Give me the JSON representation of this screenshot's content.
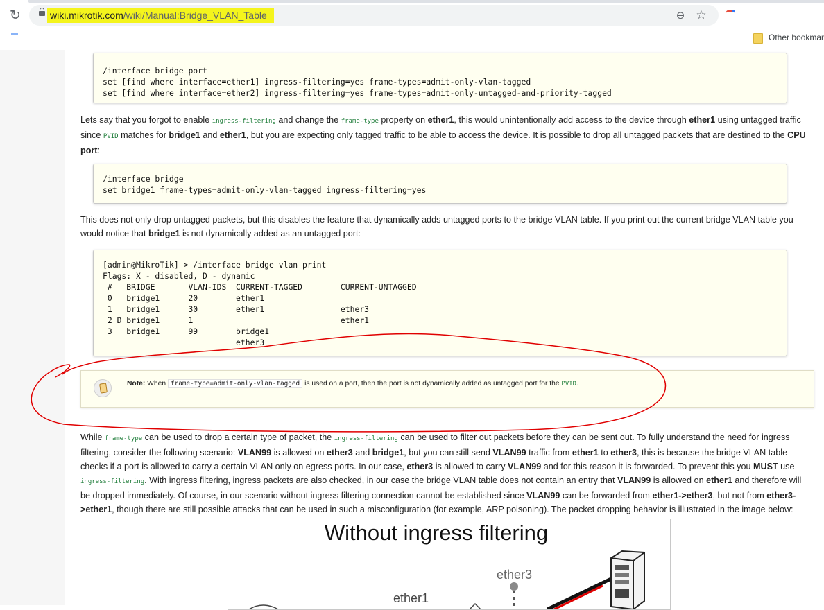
{
  "browser": {
    "url_host": "wiki.mikrotik.com",
    "url_path": "/wiki/Manual:Bridge_VLAN_Table",
    "bookmarks_label": "Other bookmar"
  },
  "code_block_1": {
    "lines": "/interface bridge port\nset [find where interface=ether1] ingress-filtering=yes frame-types=admit-only-vlan-tagged\nset [find where interface=ether2] ingress-filtering=yes frame-types=admit-only-untagged-and-priority-tagged"
  },
  "paragraph_1": {
    "t1": "Lets say that you forgot to enable ",
    "c1": "ingress-filtering",
    "t2": " and change the ",
    "c2": "frame-type",
    "t3": " property on ",
    "b1": "ether1",
    "t4": ", this would unintentionally add access to the device through ",
    "b2": "ether1",
    "t5": " using untagged traffic since ",
    "c3": "PVID",
    "t6": " matches for ",
    "b3": "bridge1",
    "t7": " and ",
    "b4": "ether1",
    "t8": ", but you are expecting only tagged traffic to be able to access the device. It is possible to drop all untagged packets that are destined to the ",
    "b5": "CPU port",
    "t9": ":"
  },
  "code_block_2": {
    "lines": "/interface bridge\nset bridge1 frame-types=admit-only-vlan-tagged ingress-filtering=yes"
  },
  "paragraph_2": {
    "t1": "This does not only drop untagged packets, but this disables the feature that dynamically adds untagged ports to the bridge VLAN table. If you print out the current bridge VLAN table you would notice that ",
    "b1": "bridge1",
    "t2": " is not dynamically added as an untagged port:"
  },
  "code_block_3": {
    "lines": "[admin@MikroTik] > /interface bridge vlan print\nFlags: X - disabled, D - dynamic\n #   BRIDGE       VLAN-IDS  CURRENT-TAGGED        CURRENT-UNTAGGED\n 0   bridge1      20        ether1\n 1   bridge1      30        ether1                ether3\n 2 D bridge1      1                               ether1\n 3   bridge1      99        bridge1\n                            ether3"
  },
  "note": {
    "label": "Note:",
    "t1": " When ",
    "code": "frame-type=admit-only-vlan-tagged",
    "t2": " is used on a port, then the port is not dynamically added as untagged port for the ",
    "c2": "PVID",
    "t3": "."
  },
  "paragraph_3": {
    "t1": "While ",
    "c1": "frame-type",
    "t2": " can be used to drop a certain type of packet, the ",
    "c2": "ingress-filtering",
    "t3": " can be used to filter out packets before they can be sent out. To fully understand the need for ingress filtering, consider the following scenario: ",
    "b1": "VLAN99",
    "t4": " is allowed on ",
    "b2": "ether3",
    "t5": " and ",
    "b3": "bridge1",
    "t6": ", but you can still send ",
    "b4": "VLAN99",
    "t7": " traffic from ",
    "b5": "ether1",
    "t8": " to ",
    "b6": "ether3",
    "t9": ", this is because the bridge VLAN table checks if a port is allowed to carry a certain VLAN only on egress ports. In our case, ",
    "b7": "ether3",
    "t10": " is allowed to carry ",
    "b8": "VLAN99",
    "t11": " and for this reason it is forwarded. To prevent this you ",
    "b9": "MUST",
    "t12": " use ",
    "c3": "ingress-filtering",
    "t13": ". With ingress filtering, ingress packets are also checked, in our case the bridge VLAN table does not contain an entry that ",
    "b10": "VLAN99",
    "t14": " is allowed on ",
    "b11": "ether1",
    "t15": " and therefore will be dropped immediately. Of course, in our scenario without ingress filtering connection cannot be established since ",
    "b12": "VLAN99",
    "t16": " can be forwarded from ",
    "b13": "ether1->ether3",
    "t17": ", but not from ",
    "b14": "ether3->ether1",
    "t18": ", though there are still possible attacks that can be used in such a misconfiguration (for example, ARP poisoning). The packet dropping behavior is illustrated in the image below:"
  },
  "diagram": {
    "title": "Without ingress filtering",
    "label_ether3": "ether3",
    "label_ether1": "ether1"
  },
  "colors": {
    "annotation": "#e00000",
    "highlight": "#f4f41d",
    "code_background": "#fffff0",
    "inline_code": "#1f7d3a"
  }
}
